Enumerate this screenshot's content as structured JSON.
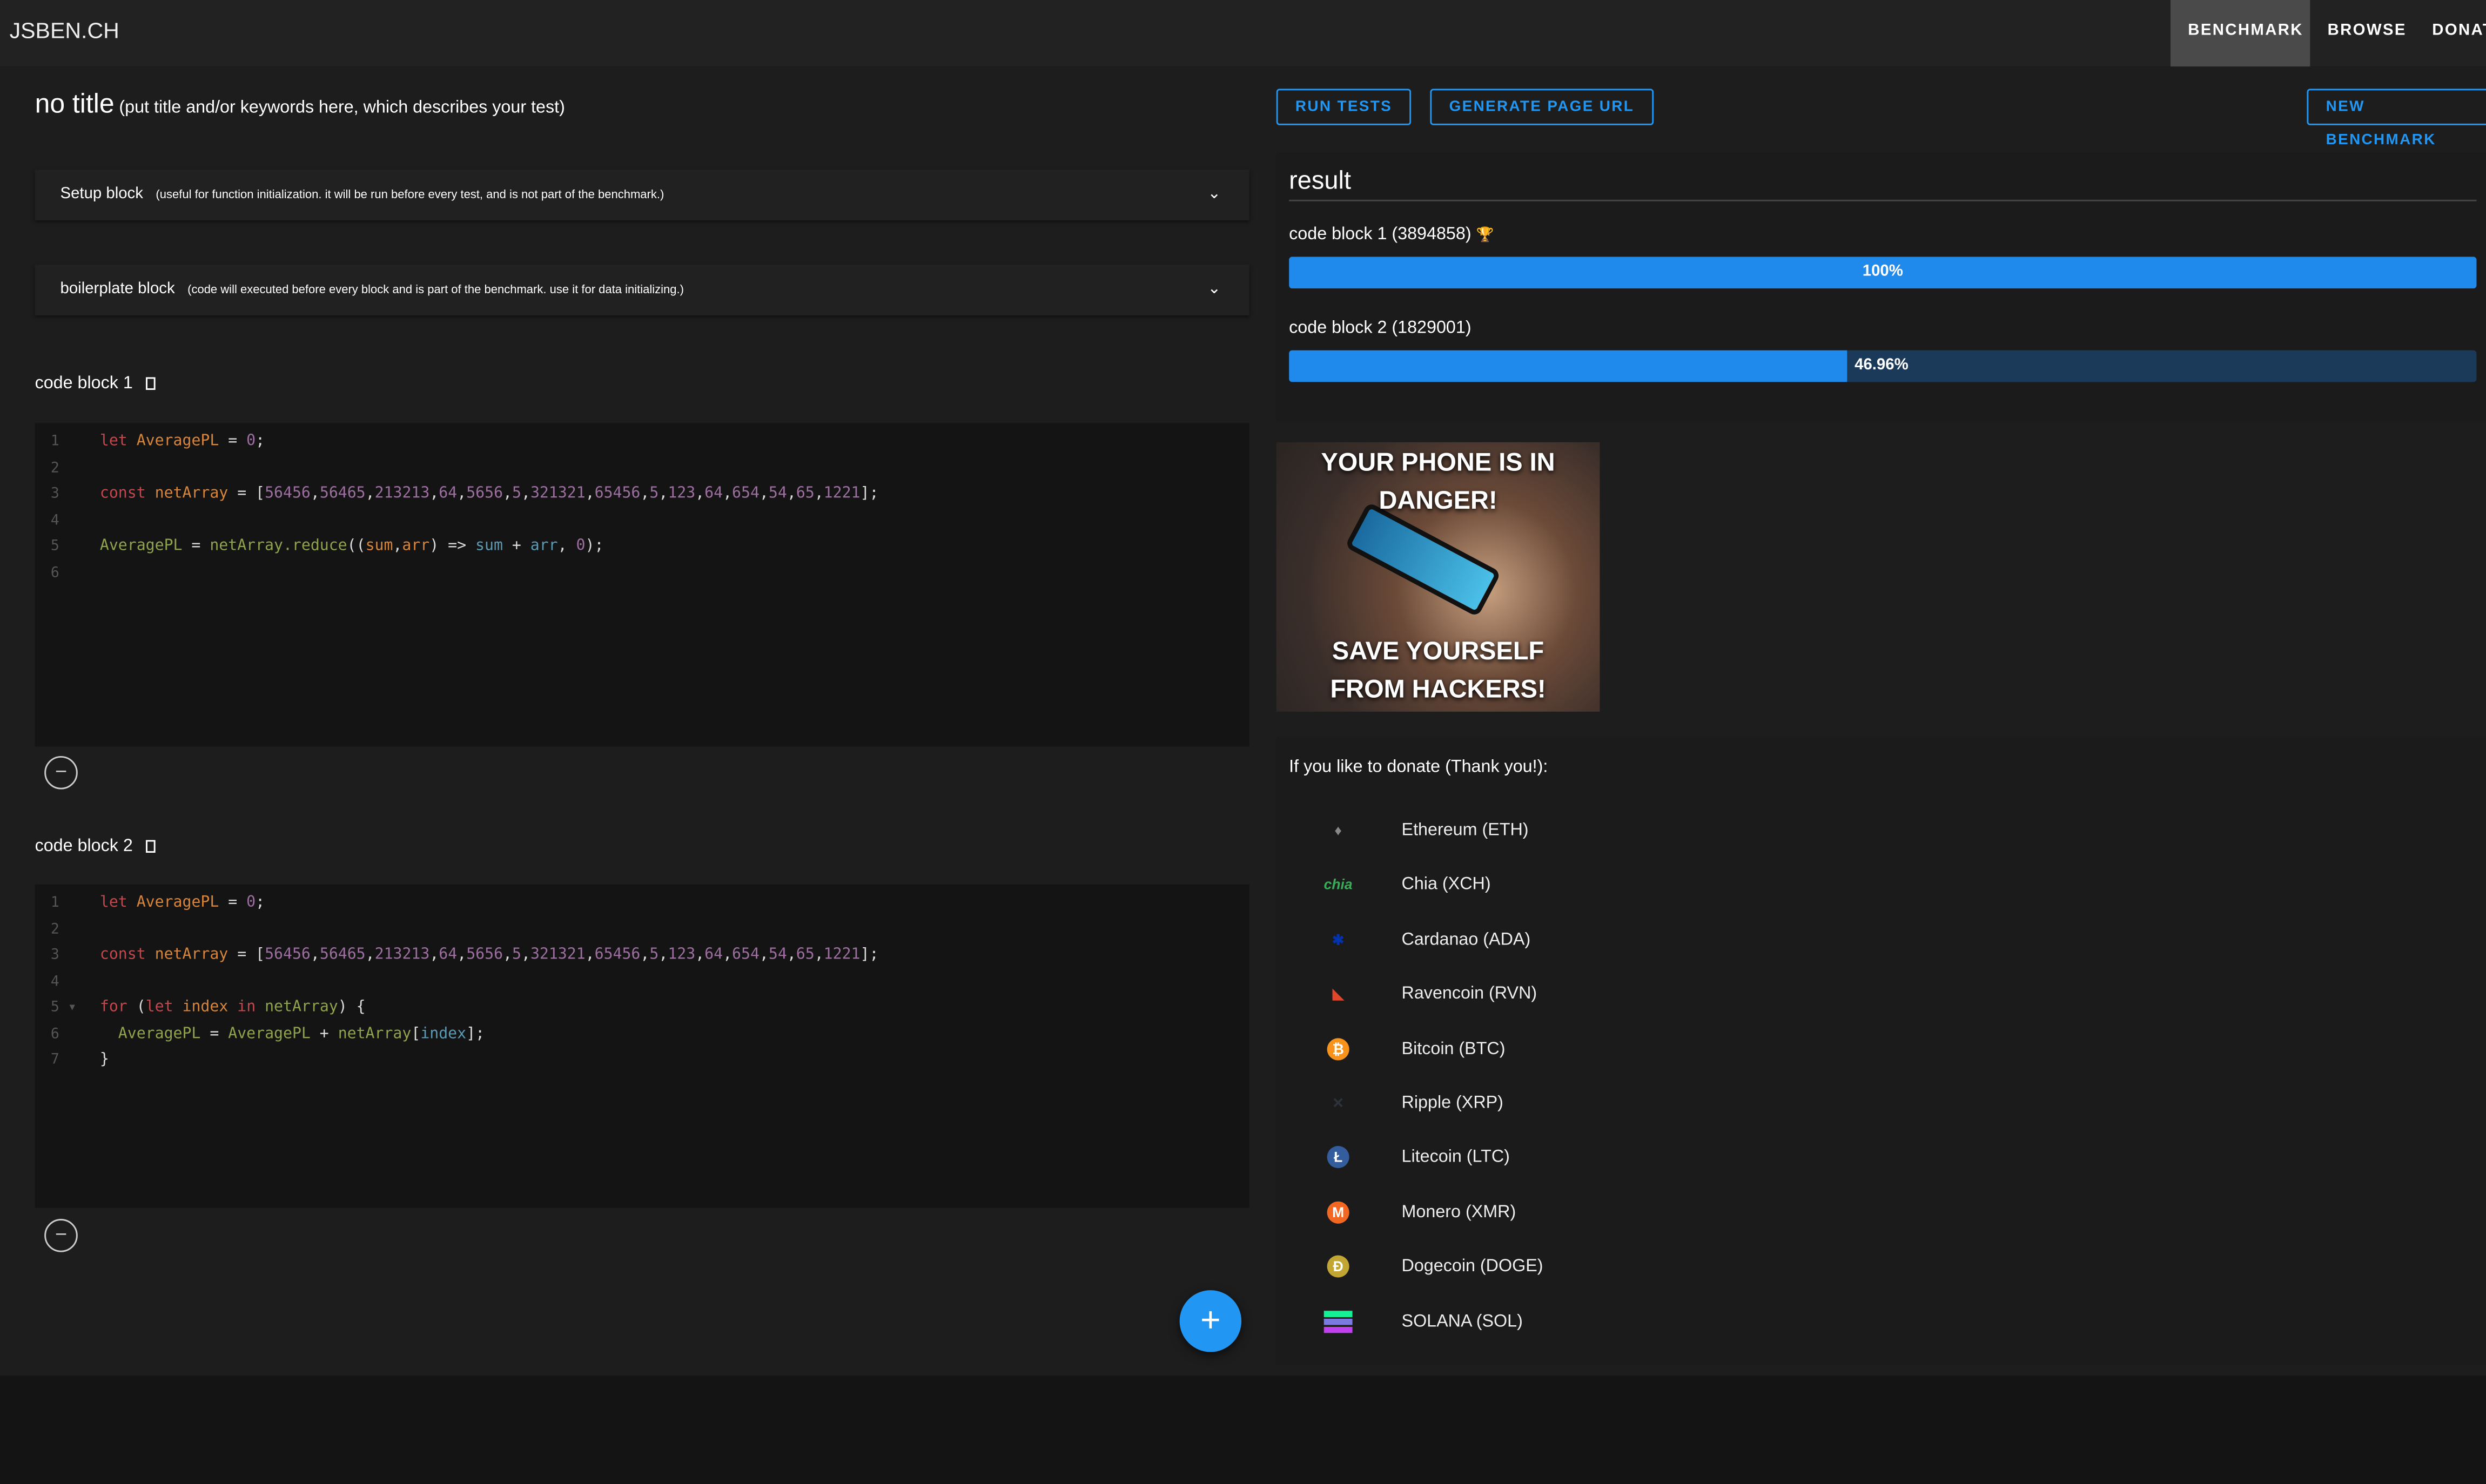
{
  "header": {
    "logo": "JSBEN.CH",
    "nav": [
      {
        "label": "BENCHMARK",
        "active": true
      },
      {
        "label": "BROWSE"
      },
      {
        "label": "DONAT"
      }
    ]
  },
  "title": {
    "main": "no title",
    "hint": "(put title and/or keywords here, which describes your test)"
  },
  "setup": {
    "label": "Setup block",
    "hint": "(useful for function initialization. it will be run before every test, and is not part of the benchmark.)"
  },
  "boilerplate": {
    "label": "boilerplate block",
    "hint": "(code will executed before every block and is part of the benchmark. use it for data initializing.)"
  },
  "code_blocks": [
    {
      "label": "code block 1",
      "lines": [
        [
          [
            "let ",
            "kw"
          ],
          [
            "AveragePL",
            "var"
          ],
          [
            " = ",
            "pl"
          ],
          [
            "0",
            "num"
          ],
          [
            ";",
            "pl"
          ]
        ],
        [],
        [
          [
            "const ",
            "kw"
          ],
          [
            "netArray",
            "var"
          ],
          [
            " = [",
            "pl"
          ],
          [
            "56456",
            "num"
          ],
          [
            ",",
            "pl"
          ],
          [
            "56465",
            "num"
          ],
          [
            ",",
            "pl"
          ],
          [
            "213213",
            "num"
          ],
          [
            ",",
            "pl"
          ],
          [
            "64",
            "num"
          ],
          [
            ",",
            "pl"
          ],
          [
            "5656",
            "num"
          ],
          [
            ",",
            "pl"
          ],
          [
            "5",
            "num"
          ],
          [
            ",",
            "pl"
          ],
          [
            "321321",
            "num"
          ],
          [
            ",",
            "pl"
          ],
          [
            "65456",
            "num"
          ],
          [
            ",",
            "pl"
          ],
          [
            "5",
            "num"
          ],
          [
            ",",
            "pl"
          ],
          [
            "123",
            "num"
          ],
          [
            ",",
            "pl"
          ],
          [
            "64",
            "num"
          ],
          [
            ",",
            "pl"
          ],
          [
            "654",
            "num"
          ],
          [
            ",",
            "pl"
          ],
          [
            "54",
            "num"
          ],
          [
            ",",
            "pl"
          ],
          [
            "65",
            "num"
          ],
          [
            ",",
            "pl"
          ],
          [
            "1221",
            "num"
          ],
          [
            "];",
            "pl"
          ]
        ],
        [],
        [
          [
            "AveragePL",
            "fn"
          ],
          [
            " = ",
            "pl"
          ],
          [
            "netArray.reduce",
            "fn"
          ],
          [
            "((",
            "pl"
          ],
          [
            "sum",
            "prm"
          ],
          [
            ",",
            "pl"
          ],
          [
            "arr",
            "prm"
          ],
          [
            ") => ",
            "pl"
          ],
          [
            "sum",
            "blu"
          ],
          [
            " + ",
            "pl"
          ],
          [
            "arr",
            "blu"
          ],
          [
            ", ",
            "pl"
          ],
          [
            "0",
            "num"
          ],
          [
            ");",
            "pl"
          ]
        ],
        []
      ]
    },
    {
      "label": "code block 2",
      "lines": [
        [
          [
            "let ",
            "kw"
          ],
          [
            "AveragePL",
            "var"
          ],
          [
            " = ",
            "pl"
          ],
          [
            "0",
            "num"
          ],
          [
            ";",
            "pl"
          ]
        ],
        [],
        [
          [
            "const ",
            "kw"
          ],
          [
            "netArray",
            "var"
          ],
          [
            " = [",
            "pl"
          ],
          [
            "56456",
            "num"
          ],
          [
            ",",
            "pl"
          ],
          [
            "56465",
            "num"
          ],
          [
            ",",
            "pl"
          ],
          [
            "213213",
            "num"
          ],
          [
            ",",
            "pl"
          ],
          [
            "64",
            "num"
          ],
          [
            ",",
            "pl"
          ],
          [
            "5656",
            "num"
          ],
          [
            ",",
            "pl"
          ],
          [
            "5",
            "num"
          ],
          [
            ",",
            "pl"
          ],
          [
            "321321",
            "num"
          ],
          [
            ",",
            "pl"
          ],
          [
            "65456",
            "num"
          ],
          [
            ",",
            "pl"
          ],
          [
            "5",
            "num"
          ],
          [
            ",",
            "pl"
          ],
          [
            "123",
            "num"
          ],
          [
            ",",
            "pl"
          ],
          [
            "64",
            "num"
          ],
          [
            ",",
            "pl"
          ],
          [
            "654",
            "num"
          ],
          [
            ",",
            "pl"
          ],
          [
            "54",
            "num"
          ],
          [
            ",",
            "pl"
          ],
          [
            "65",
            "num"
          ],
          [
            ",",
            "pl"
          ],
          [
            "1221",
            "num"
          ],
          [
            "];",
            "pl"
          ]
        ],
        [],
        [
          [
            "for ",
            "kw"
          ],
          [
            "(",
            "pl"
          ],
          [
            "let ",
            "kw"
          ],
          [
            "index ",
            "var"
          ],
          [
            "in ",
            "kw"
          ],
          [
            "netArray",
            "fn"
          ],
          [
            ") {",
            "pl"
          ]
        ],
        [
          [
            "  AveragePL",
            "fn"
          ],
          [
            " = ",
            "pl"
          ],
          [
            "AveragePL",
            "fn"
          ],
          [
            " + ",
            "pl"
          ],
          [
            "netArray",
            "fn"
          ],
          [
            "[",
            "pl"
          ],
          [
            "index",
            "blu"
          ],
          [
            "];",
            "pl"
          ]
        ],
        [
          [
            "}",
            "pl"
          ]
        ]
      ],
      "fold_line": 5
    }
  ],
  "buttons": {
    "run": "RUN TESTS",
    "url": "GENERATE PAGE URL",
    "new": "NEW BENCHMARK",
    "add": "+",
    "remove": "−"
  },
  "result": {
    "title": "result",
    "items": [
      {
        "label": "code block 1 (3894858)",
        "trophy": "🏆",
        "percent": 100,
        "percent_label": "100%"
      },
      {
        "label": "code block 2 (1829001)",
        "percent": 46.96,
        "percent_label": "46.96%"
      }
    ]
  },
  "ad": {
    "top": "YOUR PHONE IS IN DANGER!",
    "bottom": "SAVE YOURSELF FROM HACKERS!"
  },
  "donate": {
    "label": "If you like to donate (Thank you!):",
    "coins": [
      {
        "name": "Ethereum (ETH)",
        "icon": "ethereum-icon",
        "color": "#888888"
      },
      {
        "name": "Chia (XCH)",
        "icon": "chia-icon",
        "color": "#3aac59",
        "glyph": "chia"
      },
      {
        "name": "Cardanao (ADA)",
        "icon": "cardano-icon",
        "color": "#0033ad"
      },
      {
        "name": "Ravencoin (RVN)",
        "icon": "ravencoin-icon",
        "color": "#384182"
      },
      {
        "name": "Bitcoin (BTC)",
        "icon": "bitcoin-icon",
        "color": "#f7931a",
        "glyph": "₿"
      },
      {
        "name": "Ripple (XRP)",
        "icon": "ripple-icon",
        "color": "#23292f"
      },
      {
        "name": "Litecoin (LTC)",
        "icon": "litecoin-icon",
        "color": "#345d9d",
        "glyph": "Ł"
      },
      {
        "name": "Monero (XMR)",
        "icon": "monero-icon",
        "color": "#f26822",
        "glyph": "M"
      },
      {
        "name": "Dogecoin (DOGE)",
        "icon": "dogecoin-icon",
        "color": "#c2a633",
        "glyph": "Ð"
      },
      {
        "name": "SOLANA (SOL)",
        "icon": "solana-icon",
        "color": "#9945ff"
      }
    ]
  }
}
